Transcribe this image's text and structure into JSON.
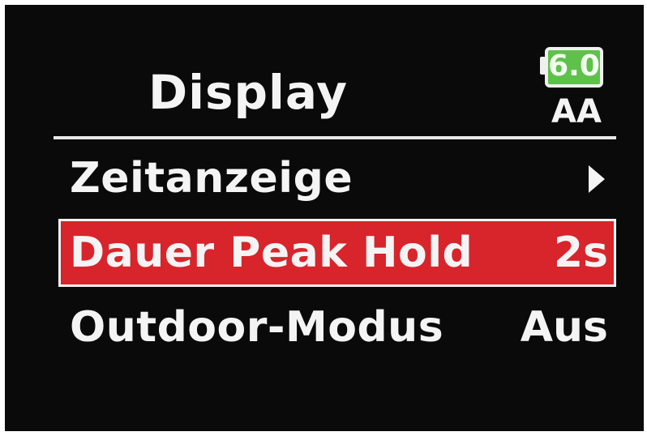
{
  "screen": {
    "title": "Display",
    "battery": {
      "value": "6.0",
      "type": "AA",
      "color": "#5ec24a"
    },
    "menu": {
      "items": [
        {
          "label": "Zeitanzeige",
          "value": "",
          "icon": "chevron-right-icon",
          "selected": false
        },
        {
          "label": "Dauer Peak Hold",
          "value": "2s",
          "selected": true
        },
        {
          "label": "Outdoor-Modus",
          "value": "Aus",
          "selected": false
        }
      ]
    },
    "colors": {
      "background": "#0a0a0a",
      "highlight": "#d8242b",
      "text": "#f4f4f4"
    }
  }
}
